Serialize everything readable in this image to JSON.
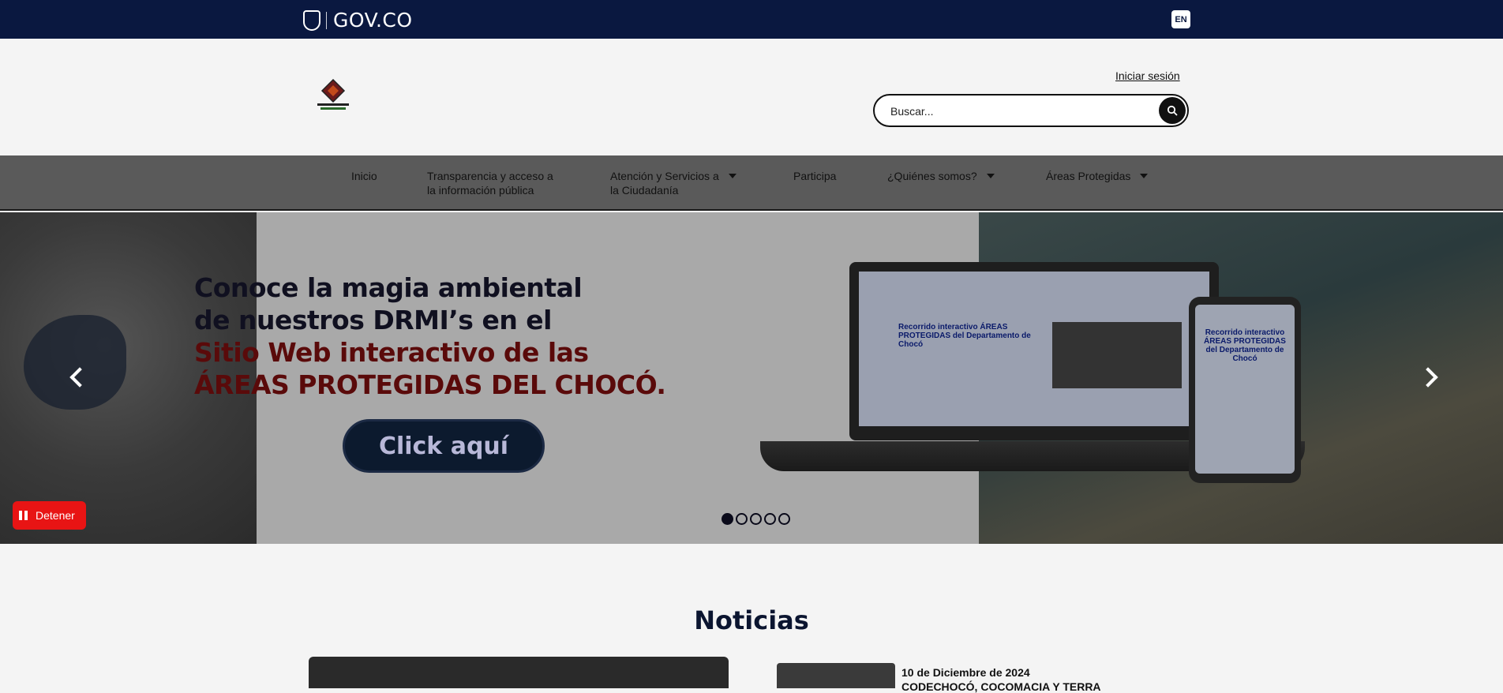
{
  "govbar": {
    "brand": "GOV.CO",
    "lang": "EN"
  },
  "header": {
    "login": "Iniciar sesión",
    "search_placeholder": "Buscar..."
  },
  "nav": {
    "items": [
      {
        "label": "Inicio",
        "dropdown": false
      },
      {
        "label_line1": "Transparencia y acceso a",
        "label_line2": "la información pública",
        "dropdown": false
      },
      {
        "label_line1": "Atención y Servicios a",
        "label_line2": "la Ciudadanía",
        "dropdown": true
      },
      {
        "label": "Participa",
        "dropdown": false
      },
      {
        "label": "¿Quiénes somos?",
        "dropdown": true
      },
      {
        "label": "Áreas Protegidas",
        "dropdown": true
      }
    ]
  },
  "hero": {
    "line1": "Conoce la magia ambiental",
    "line2": "de nuestros DRMI’s en el",
    "line3": "Sitio Web interactivo de las",
    "line4": "ÁREAS PROTEGIDAS DEL CHOCÓ.",
    "cta": "Click aquí",
    "screen_title": "Recorrido interactivo ÁREAS PROTEGIDAS del Departamento de Chocó",
    "stop_label": "Detener",
    "slide_count": 5,
    "active_slide": 1
  },
  "news": {
    "title": "Noticias",
    "items": [
      {
        "date": "10 de Diciembre de 2024",
        "headline": "CODECHOCÓ, COCOMACIA Y TERRA"
      }
    ]
  },
  "colors": {
    "govbar": "#0a1840",
    "nav": "#5a5a5a",
    "stop": "#e81414"
  }
}
